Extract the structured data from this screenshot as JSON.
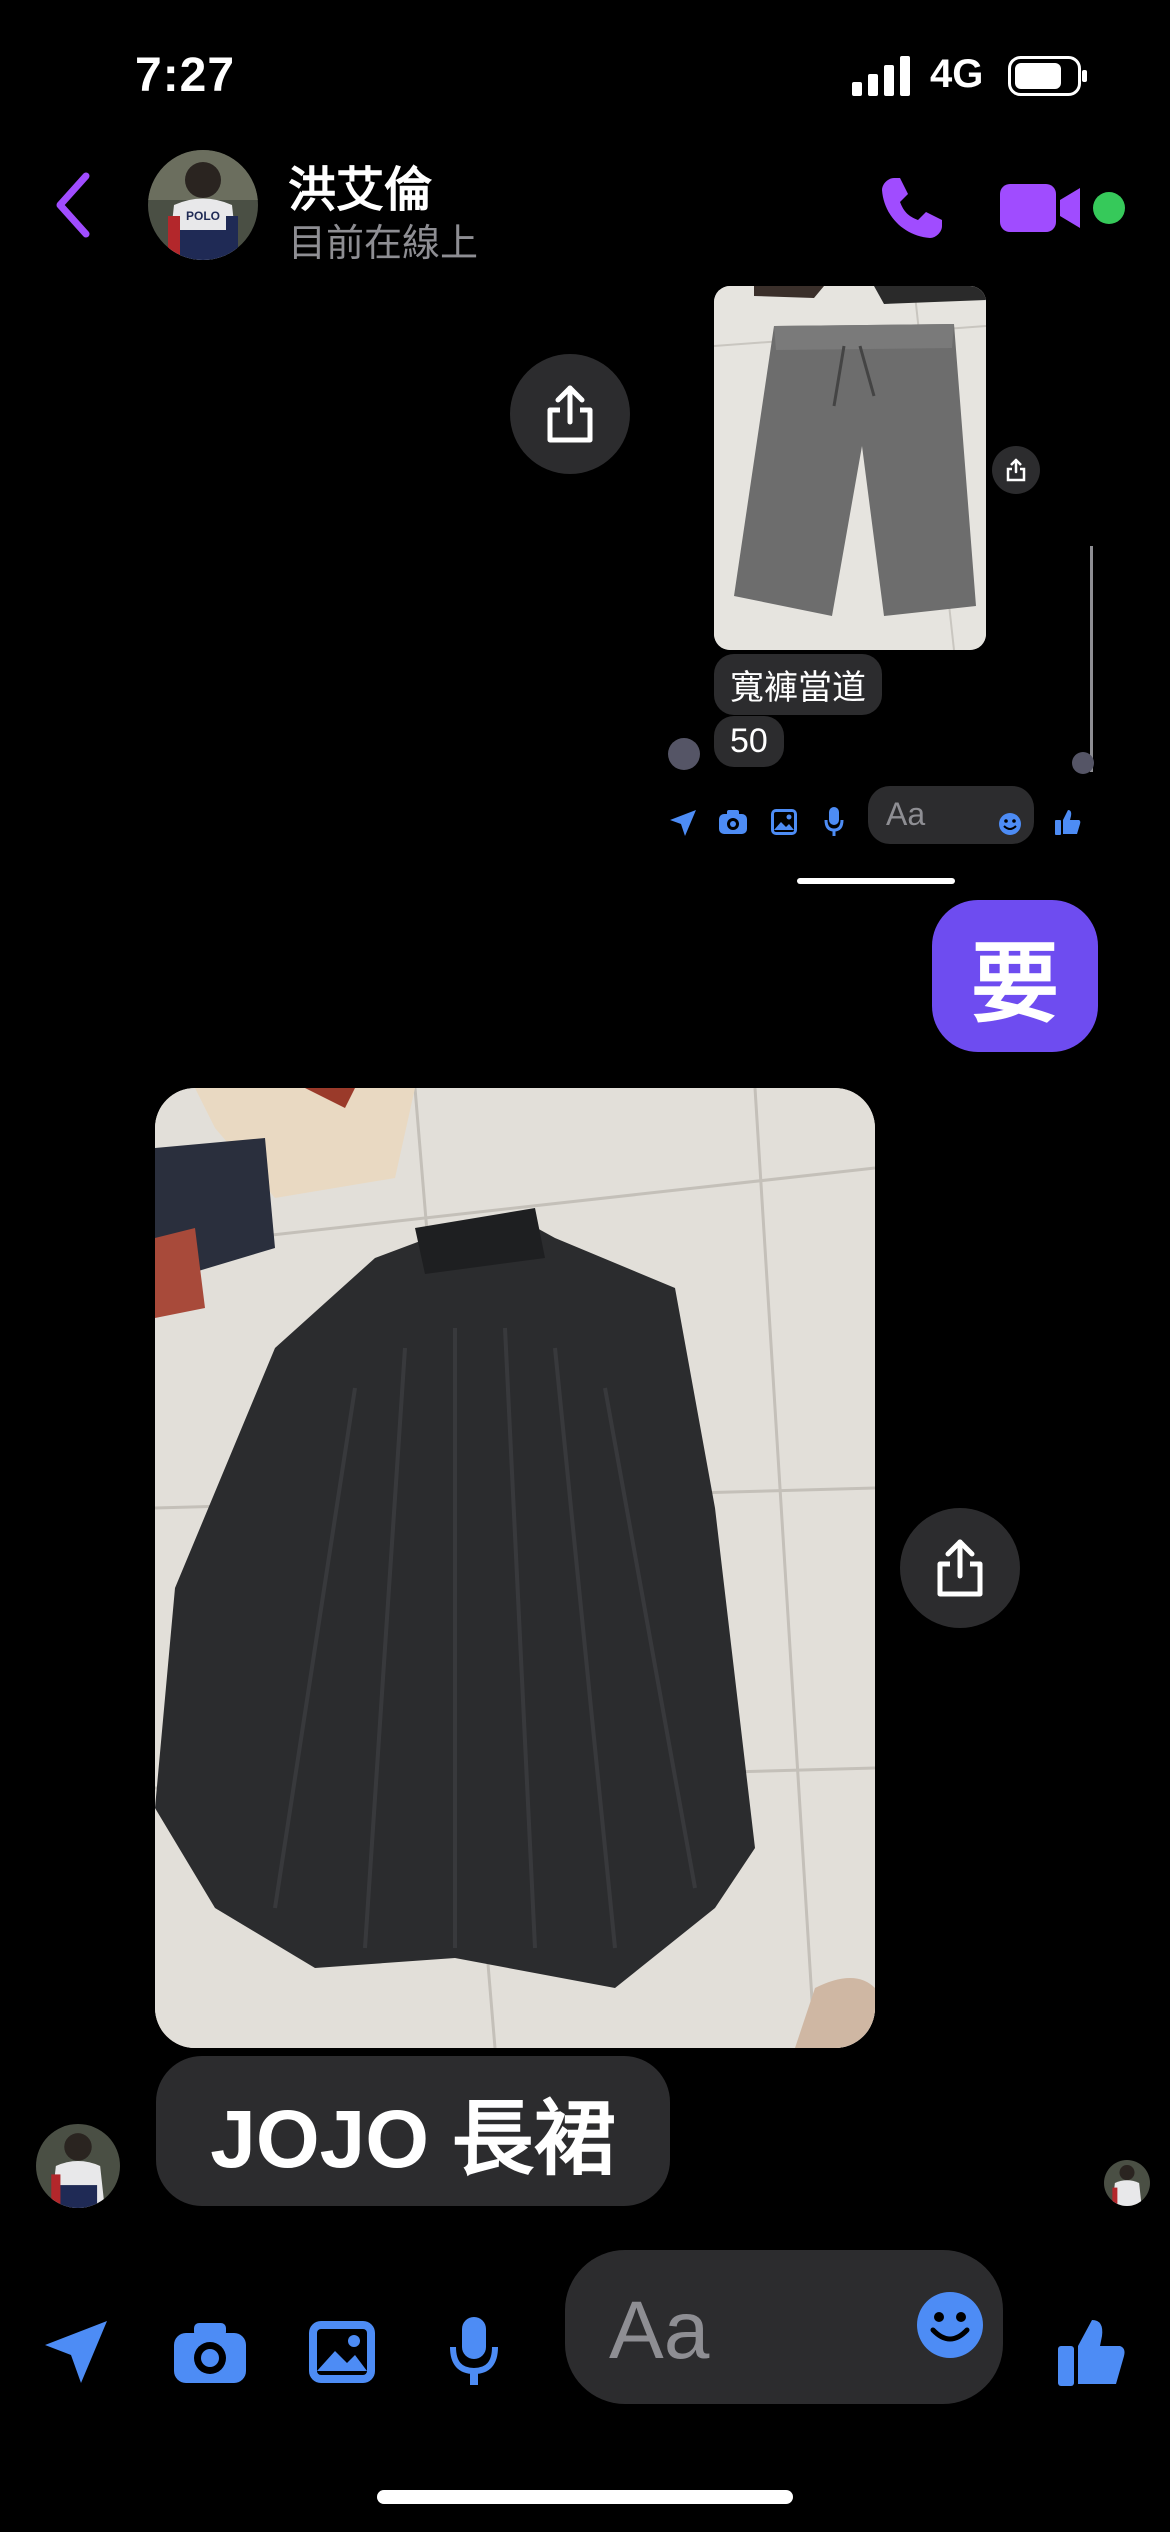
{
  "status_bar": {
    "time": "7:27",
    "network": "4G"
  },
  "header": {
    "name": "洪艾倫",
    "status": "目前在線上"
  },
  "embedded": {
    "caption": "寬褲當道",
    "price": "50",
    "input_placeholder": "Aa"
  },
  "messages": {
    "my_reply": "要",
    "item_caption": "JOJO 長裙"
  },
  "composer": {
    "placeholder": "Aa"
  },
  "colors": {
    "accent": "#a04cff",
    "bubble_me": "#6e4cf0",
    "bubble_other": "#2c2c2e",
    "toolbar_icon": "#4d8cf5",
    "online": "#36c95a"
  }
}
